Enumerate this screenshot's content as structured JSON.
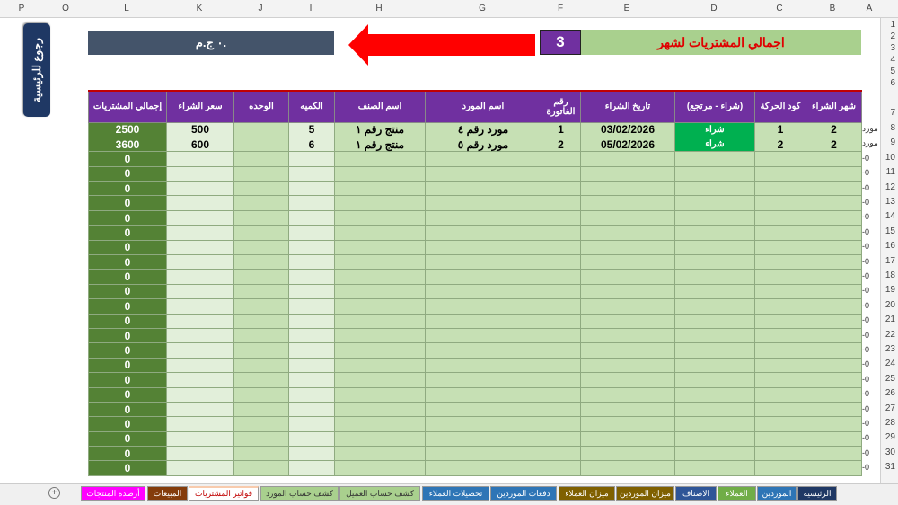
{
  "col_letters": [
    "P",
    "O",
    "L",
    "K",
    "J",
    "I",
    "H",
    "G",
    "F",
    "E",
    "D",
    "C",
    "B",
    "A"
  ],
  "back_button": "رجوع للرئيسية",
  "total_value": "٠ ج.م.",
  "month_number": "3",
  "title": "اجمالي المشتريات لشهر",
  "table": {
    "headers": [
      "إجمالي المشتريات",
      "سعر الشراء",
      "الوحده",
      "الكميه",
      "اسم الصنف",
      "اسم المورد",
      "رقم الفاتورة",
      "تاريخ الشراء",
      "(شراء - مرتجع)",
      "كود الحركة",
      "شهر الشراء"
    ],
    "rows": [
      [
        "2500",
        "500",
        "",
        "5",
        "منتج رقم ١",
        "مورد رقم ٤",
        "1",
        "03/02/2026",
        "شراء",
        "1",
        "2"
      ],
      [
        "3600",
        "600",
        "",
        "6",
        "منتج رقم ١",
        "مورد رقم ٥",
        "2",
        "05/02/2026",
        "شراء",
        "2",
        "2"
      ]
    ],
    "empty_total": "0",
    "a_col_data": "مورد",
    "a_col_empty": "-0"
  },
  "tabs": [
    {
      "label": "الرئيسيه",
      "color": "#1f3864"
    },
    {
      "label": "الموردين",
      "color": "#2e75b6"
    },
    {
      "label": "العملاء",
      "color": "#70ad47"
    },
    {
      "label": "الاصناف",
      "color": "#2f5597"
    },
    {
      "label": "ميزان الموردين",
      "color": "#7f6000"
    },
    {
      "label": "ميزان العملاء",
      "color": "#7f6000"
    },
    {
      "label": "دفعات الموردين",
      "color": "#2e75b6"
    },
    {
      "label": "تحصيلات العملاء",
      "color": "#2e75b6"
    },
    {
      "label": "كشف حساب العميل",
      "color": "#a9d08e"
    },
    {
      "label": "كشف حساب المورد",
      "color": "#a9d08e"
    },
    {
      "label": "فواتير المشتريات",
      "color": "#f8cbad"
    },
    {
      "label": "المبيعات",
      "color": "#843c0c"
    },
    {
      "label": "أرصدة المنتجات",
      "color": "#ff00ff"
    }
  ]
}
